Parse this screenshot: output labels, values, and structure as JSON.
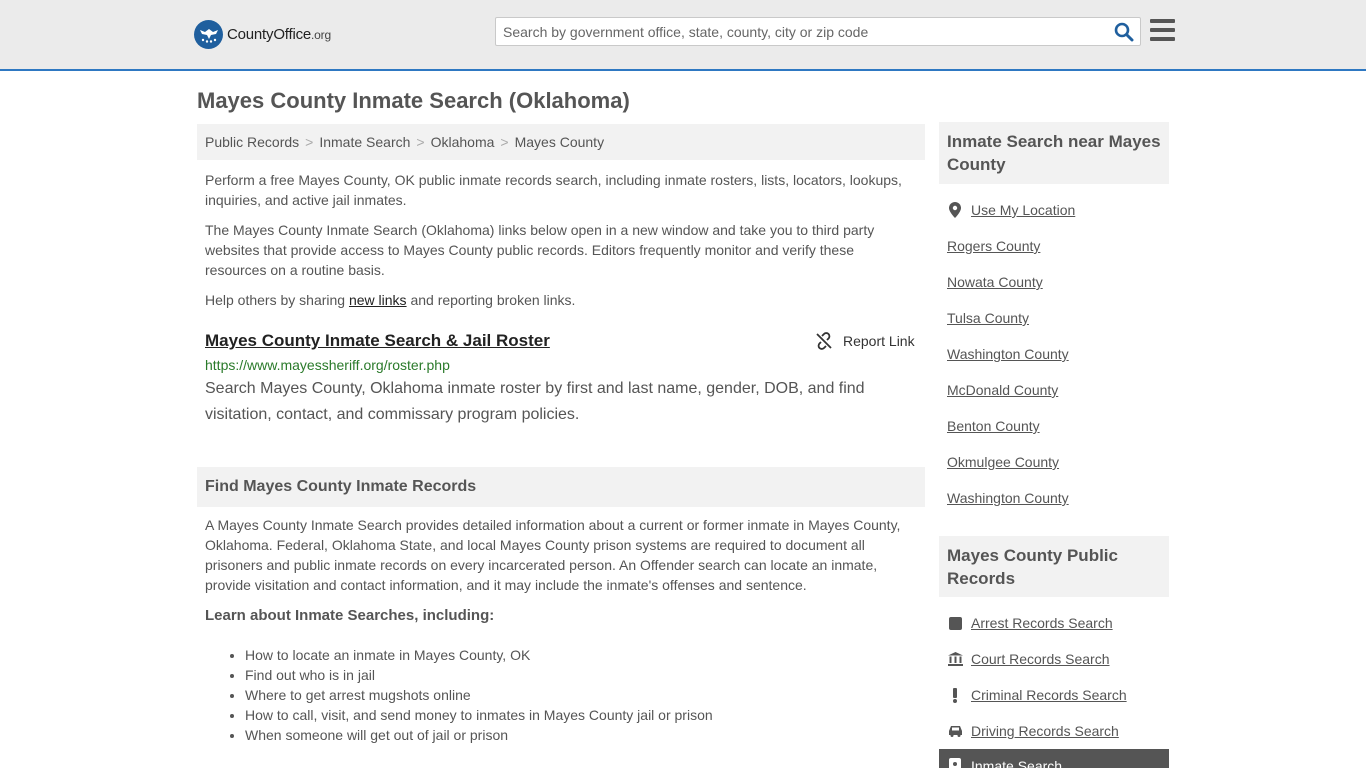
{
  "header": {
    "logo_main": "CountyOffice",
    "logo_suffix": ".org",
    "search_placeholder": "Search by government office, state, county, city or zip code"
  },
  "page_title": "Mayes County Inmate Search (Oklahoma)",
  "breadcrumb": [
    "Public Records",
    "Inmate Search",
    "Oklahoma",
    "Mayes County"
  ],
  "intro": {
    "p1": "Perform a free Mayes County, OK public inmate records search, including inmate rosters, lists, locators, lookups, inquiries, and active jail inmates.",
    "p2": "The Mayes County Inmate Search (Oklahoma) links below open in a new window and take you to third party websites that provide access to Mayes County public records. Editors frequently monitor and verify these resources on a routine basis.",
    "p3_before": "Help others by sharing ",
    "p3_link": "new links",
    "p3_after": " and reporting broken links."
  },
  "result": {
    "title": "Mayes County Inmate Search & Jail Roster",
    "report_label": "Report Link",
    "url": "https://www.mayessheriff.org/roster.php",
    "description": "Search Mayes County, Oklahoma inmate roster by first and last name, gender, DOB, and find visitation, contact, and commissary program policies."
  },
  "find_section": {
    "heading": "Find Mayes County Inmate Records",
    "paragraph": "A Mayes County Inmate Search provides detailed information about a current or former inmate in Mayes County, Oklahoma. Federal, Oklahoma State, and local Mayes County prison systems are required to document all prisoners and public inmate records on every incarcerated person. An Offender search can locate an inmate, provide visitation and contact information, and it may include the inmate's offenses and sentence.",
    "learn_heading": "Learn about Inmate Searches, including:",
    "bullets": [
      "How to locate an inmate in Mayes County, OK",
      "Find out who is in jail",
      "Where to get arrest mugshots online",
      "How to call, visit, and send money to inmates in Mayes County jail or prison",
      "When someone will get out of jail or prison"
    ]
  },
  "sidebar": {
    "nearby_heading": "Inmate Search near Mayes County",
    "use_location": "Use My Location",
    "nearby": [
      "Rogers County",
      "Nowata County",
      "Tulsa County",
      "Washington County",
      "McDonald County",
      "Benton County",
      "Okmulgee County",
      "Washington County"
    ],
    "records_heading": "Mayes County Public Records",
    "records": [
      "Arrest Records Search",
      "Court Records Search",
      "Criminal Records Search",
      "Driving Records Search"
    ],
    "active": "Inmate Search"
  }
}
